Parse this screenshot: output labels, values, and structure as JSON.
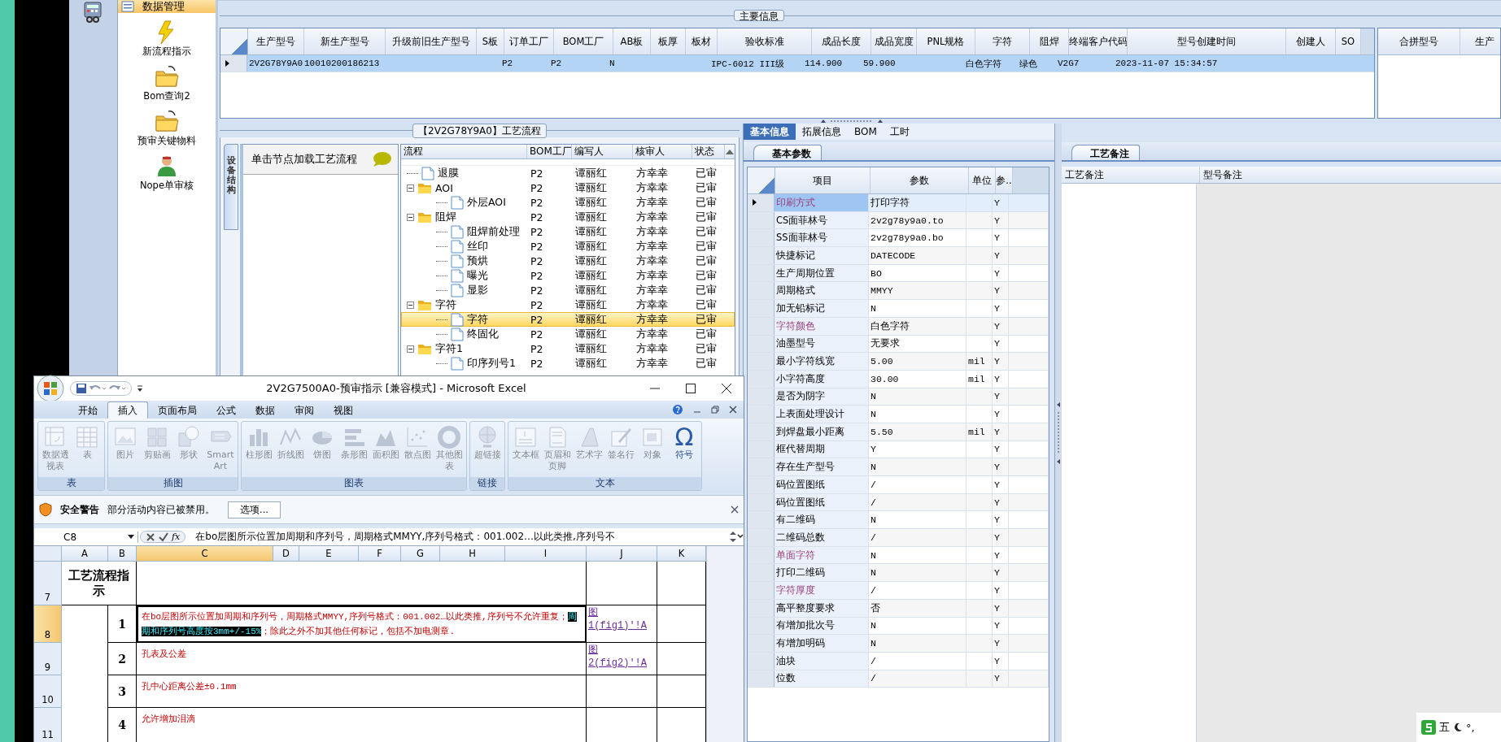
{
  "sidebar": {
    "header": "数据管理",
    "items": [
      {
        "label": "新流程指示"
      },
      {
        "label": "Bom查询2"
      },
      {
        "label": "预审关键物料"
      },
      {
        "label": "Nope单审核"
      }
    ]
  },
  "main_info": {
    "title": "主要信息",
    "columns": [
      "生产型号",
      "新生产型号",
      "升级前旧生产型号",
      "S板",
      "订单工厂",
      "BOM工厂",
      "AB板",
      "板厚",
      "板材",
      "验收标准",
      "成品长度",
      "成品宽度",
      "PNL规格",
      "字符",
      "阻焊",
      "终端客户代码",
      "型号创建时间",
      "创建人",
      "SO"
    ],
    "rows": [
      {
        "selected": true,
        "cells": [
          "2V2G78Y9A0",
          "10010200186213",
          null,
          null,
          "P2",
          "P2",
          "N",
          null,
          null,
          "IPC-6012 III级",
          "114.900",
          "59.900",
          null,
          "白色字符",
          "绿色",
          "V2G7",
          "2023-11-07 15:34:57",
          null,
          null
        ]
      }
    ],
    "side_columns": [
      "合拼型号",
      "生产"
    ]
  },
  "process": {
    "title": "【2V2G78Y9A0】工艺流程",
    "side_tab": "设备结构",
    "hint": "单击节点加载工艺流程",
    "columns": [
      "流程",
      "BOM工厂",
      "编写人",
      "核审人",
      "状态"
    ],
    "tree": [
      {
        "children": [
          {
            "label": "退膜",
            "kind": "file",
            "selected": false,
            "cells": [
              "P2",
              "谭丽红",
              "方幸幸",
              "已审"
            ]
          }
        ]
      },
      {
        "label": "AOI",
        "kind": "folder",
        "expanded": true,
        "selected": false,
        "cells": [
          "P2",
          "谭丽红",
          "方幸幸",
          "已审"
        ],
        "children": [
          {
            "label": "外层AOI",
            "kind": "file",
            "selected": false,
            "cells": [
              "P2",
              "谭丽红",
              "方幸幸",
              "已审"
            ]
          }
        ]
      },
      {
        "label": "阻焊",
        "kind": "folder",
        "expanded": true,
        "selected": false,
        "cells": [
          "P2",
          "谭丽红",
          "方幸幸",
          "已审"
        ],
        "children": [
          {
            "label": "阻焊前处理",
            "kind": "file",
            "selected": false,
            "cells": [
              "P2",
              "谭丽红",
              "方幸幸",
              "已审"
            ]
          },
          {
            "label": "丝印",
            "kind": "file",
            "selected": false,
            "cells": [
              "P2",
              "谭丽红",
              "方幸幸",
              "已审"
            ]
          },
          {
            "label": "预烘",
            "kind": "file",
            "selected": false,
            "cells": [
              "P2",
              "谭丽红",
              "方幸幸",
              "已审"
            ]
          },
          {
            "label": "曝光",
            "kind": "file",
            "selected": false,
            "cells": [
              "P2",
              "谭丽红",
              "方幸幸",
              "已审"
            ]
          },
          {
            "label": "显影",
            "kind": "file",
            "selected": false,
            "cells": [
              "P2",
              "谭丽红",
              "方幸幸",
              "已审"
            ]
          }
        ]
      },
      {
        "label": "字符",
        "kind": "folder",
        "expanded": true,
        "selected": false,
        "cells": [
          "P2",
          "谭丽红",
          "方幸幸",
          "已审"
        ],
        "children": [
          {
            "label": "字符",
            "kind": "file",
            "selected": true,
            "cells": [
              "P2",
              "谭丽红",
              "方幸幸",
              "已审"
            ]
          },
          {
            "label": "终固化",
            "kind": "file",
            "selected": false,
            "cells": [
              "P2",
              "谭丽红",
              "方幸幸",
              "已审"
            ]
          }
        ]
      },
      {
        "label": "字符1",
        "kind": "folder",
        "expanded": true,
        "selected": false,
        "cells": [
          "P2",
          "谭丽红",
          "方幸幸",
          "已审"
        ],
        "children": [
          {
            "label": "印序列号1",
            "kind": "file",
            "selected": false,
            "cells": [
              "P2",
              "谭丽红",
              "方幸幸",
              "已审"
            ]
          }
        ]
      }
    ]
  },
  "details": {
    "tabs": [
      {
        "label": "基本信息",
        "selected": true
      },
      {
        "label": "拓展信息",
        "selected": false
      },
      {
        "label": "BOM",
        "selected": false
      },
      {
        "label": "工时",
        "selected": false
      }
    ],
    "subtab": "基本参数",
    "columns": [
      "项目",
      "参数",
      "单位",
      "参.."
    ],
    "rows": [
      {
        "item": "印刷方式",
        "value": "打印字符",
        "flag": "Y",
        "highlighted": true,
        "selected": true
      },
      {
        "item": "CS面菲林号",
        "value": "2v2g78y9a0.to",
        "flag": "Y",
        "highlighted": false,
        "selected": false
      },
      {
        "item": "SS面菲林号",
        "value": "2v2g78y9a0.bo",
        "flag": "Y",
        "highlighted": false,
        "selected": false
      },
      {
        "item": "快捷标记",
        "value": "DATECODE",
        "flag": "Y",
        "highlighted": false,
        "selected": false
      },
      {
        "item": "生产周期位置",
        "value": "BO",
        "flag": "Y",
        "highlighted": false,
        "selected": false
      },
      {
        "item": "周期格式",
        "value": "MMYY",
        "flag": "Y",
        "highlighted": false,
        "selected": false
      },
      {
        "item": "加无铅标记",
        "value": "N",
        "flag": "Y",
        "highlighted": false,
        "selected": false
      },
      {
        "item": "字符颜色",
        "value": "白色字符",
        "flag": "Y",
        "highlighted": true,
        "selected": false
      },
      {
        "item": "油墨型号",
        "value": "无要求",
        "flag": "Y",
        "highlighted": false,
        "selected": false
      },
      {
        "item": "最小字符线宽",
        "value": "5.00",
        "unit": "mil",
        "flag": "Y",
        "highlighted": false,
        "selected": false
      },
      {
        "item": "小字符高度",
        "value": "30.00",
        "unit": "mil",
        "flag": "Y",
        "highlighted": false,
        "selected": false
      },
      {
        "item": "是否为阴字",
        "value": "N",
        "flag": "Y",
        "highlighted": false,
        "selected": false
      },
      {
        "item": "上表面处理设计",
        "value": "N",
        "flag": "Y",
        "highlighted": false,
        "selected": false
      },
      {
        "item": "到焊盘最小距离",
        "value": "5.50",
        "unit": "mil",
        "flag": "Y",
        "highlighted": false,
        "selected": false
      },
      {
        "item": "框代替周期",
        "value": "Y",
        "flag": "Y",
        "highlighted": false,
        "selected": false
      },
      {
        "item": "存在生产型号",
        "value": "N",
        "flag": "Y",
        "highlighted": false,
        "selected": false
      },
      {
        "item": "码位置图纸",
        "value": "/",
        "flag": "Y",
        "highlighted": false,
        "selected": false
      },
      {
        "item": "码位置图纸",
        "value": "/",
        "flag": "Y",
        "highlighted": false,
        "selected": false
      },
      {
        "item": "有二维码",
        "value": "N",
        "flag": "Y",
        "highlighted": false,
        "selected": false
      },
      {
        "item": "二维码总数",
        "value": "/",
        "flag": "Y",
        "highlighted": false,
        "selected": false
      },
      {
        "item": "单面字符",
        "value": "N",
        "flag": "Y",
        "highlighted": true,
        "selected": false
      },
      {
        "item": "打印二维码",
        "value": "N",
        "flag": "Y",
        "highlighted": false,
        "selected": false
      },
      {
        "item": "字符厚度",
        "value": "/",
        "flag": "Y",
        "highlighted": true,
        "selected": false
      },
      {
        "item": "高平整度要求",
        "value": "否",
        "flag": "Y",
        "highlighted": false,
        "selected": false
      },
      {
        "item": "有增加批次号",
        "value": "N",
        "flag": "Y",
        "highlighted": false,
        "selected": false
      },
      {
        "item": "有增加明码",
        "value": "N",
        "flag": "Y",
        "highlighted": false,
        "selected": false
      },
      {
        "item": "油块",
        "value": "/",
        "flag": "Y",
        "highlighted": false,
        "selected": false
      },
      {
        "item": "位数",
        "value": "/",
        "flag": "Y",
        "highlighted": false,
        "selected": false
      }
    ]
  },
  "notes": {
    "tab": "工艺备注",
    "columns": [
      "工艺备注",
      "型号备注"
    ]
  },
  "excel": {
    "title": "2V2G7500A0-预审指示  [兼容模式] - Microsoft Excel",
    "tabs": [
      {
        "label": "开始",
        "selected": false
      },
      {
        "label": "插入",
        "selected": true
      },
      {
        "label": "页面布局",
        "selected": false
      },
      {
        "label": "公式",
        "selected": false
      },
      {
        "label": "数据",
        "selected": false
      },
      {
        "label": "审阅",
        "selected": false
      },
      {
        "label": "视图",
        "selected": false
      }
    ],
    "groups": [
      {
        "label": "表",
        "buttons": [
          {
            "label": "数据透视表",
            "disabled": true
          },
          {
            "label": "表",
            "disabled": true
          }
        ]
      },
      {
        "label": "插图",
        "buttons": [
          {
            "label": "图片",
            "disabled": true
          },
          {
            "label": "剪贴画",
            "disabled": true
          },
          {
            "label": "形状",
            "disabled": true
          },
          {
            "label": "SmartArt",
            "disabled": true
          }
        ]
      },
      {
        "label": "图表",
        "buttons": [
          {
            "label": "柱形图",
            "disabled": true
          },
          {
            "label": "折线图",
            "disabled": true
          },
          {
            "label": "饼图",
            "disabled": true
          },
          {
            "label": "条形图",
            "disabled": true
          },
          {
            "label": "面积图",
            "disabled": true
          },
          {
            "label": "散点图",
            "disabled": true
          },
          {
            "label": "其他图表",
            "disabled": true
          }
        ]
      },
      {
        "label": "链接",
        "buttons": [
          {
            "label": "超链接",
            "disabled": true
          }
        ]
      },
      {
        "label": "文本",
        "buttons": [
          {
            "label": "文本框",
            "disabled": true
          },
          {
            "label": "页眉和页脚",
            "disabled": true
          },
          {
            "label": "艺术字",
            "disabled": true
          },
          {
            "label": "签名行",
            "disabled": true
          },
          {
            "label": "对象",
            "disabled": true
          },
          {
            "label": "符号",
            "glyph": "Ω",
            "disabled": false
          }
        ]
      }
    ],
    "security": {
      "title": "安全警告",
      "message": "部分活动内容已被禁用。",
      "button": "选项..."
    },
    "formula": {
      "cell": "C8",
      "function_button": "fx",
      "text": "在bo层图所示位置加周期和序列号，周期格式MMYY,序列号格式：001.002…以此类推,序列号不"
    },
    "columns": [
      {
        "label": "A",
        "selected": false
      },
      {
        "label": "B",
        "selected": false
      },
      {
        "label": "C",
        "selected": true
      },
      {
        "label": "D",
        "selected": false
      },
      {
        "label": "E",
        "selected": false
      },
      {
        "label": "F",
        "selected": false
      },
      {
        "label": "G",
        "selected": false
      },
      {
        "label": "H",
        "selected": false
      },
      {
        "label": "I",
        "selected": false
      },
      {
        "label": "J",
        "selected": false
      },
      {
        "label": "K",
        "selected": false
      }
    ],
    "rows": [
      {
        "number": "7",
        "selected": false,
        "a": "工艺流程指示"
      },
      {
        "number": "8",
        "selected": true,
        "b": "1",
        "c": [
          {
            "text": "在bo层图所示位置加周期和序列号，周期格式MMYY,序列号格式：001.002…以此类推,序列号不允许重复；",
            "highlighted": false
          },
          {
            "text": "周期和序列号高度按3mm+/-15%",
            "highlighted": true
          },
          {
            "text": "；除此之外不加其他任何标记，包括不加电测章.",
            "highlighted": false
          }
        ],
        "j": "图 1(fig1)'!A"
      },
      {
        "number": "9",
        "selected": false,
        "b": "2",
        "c": [
          {
            "text": "孔表及公差",
            "highlighted": false
          }
        ],
        "j": "图 2(fig2)'!A"
      },
      {
        "number": "10",
        "selected": false,
        "b": "3",
        "c": [
          {
            "text": "孔中心距离公差±0.1mm",
            "highlighted": false
          }
        ]
      },
      {
        "number": "11",
        "selected": false,
        "b": "4",
        "c": [
          {
            "text": "允许增加泪滴",
            "highlighted": false
          }
        ]
      }
    ]
  },
  "tray": {
    "items": [
      "五",
      "°,"
    ]
  }
}
